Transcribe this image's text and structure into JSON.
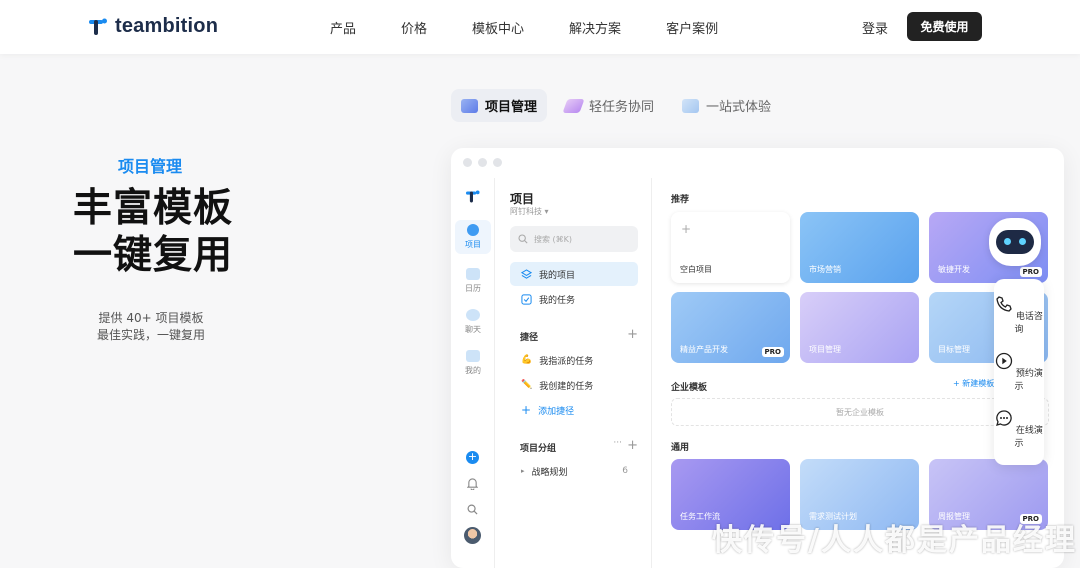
{
  "brand": {
    "name": "teambition"
  },
  "nav": {
    "items": [
      "产品",
      "价格",
      "模板中心",
      "解决方案",
      "客户案例"
    ],
    "login": "登录",
    "cta": "免费使用"
  },
  "hero": {
    "kicker": "项目管理",
    "title_line1": "丰富模板",
    "title_line2": "一键复用",
    "desc_line1": "提供 40+ 项目模板",
    "desc_line2": "最佳实践，一键复用"
  },
  "tabs": [
    {
      "label": "项目管理",
      "icon": "folder-icon",
      "active": true
    },
    {
      "label": "轻任务协同",
      "icon": "eraser-icon",
      "active": false
    },
    {
      "label": "一站式体验",
      "icon": "monitor-icon",
      "active": false
    }
  ],
  "app": {
    "rail": [
      {
        "label": "项目",
        "icon": "project-icon"
      },
      {
        "label": "日历",
        "icon": "calendar-icon"
      },
      {
        "label": "聊天",
        "icon": "chat-icon"
      },
      {
        "label": "我的",
        "icon": "me-icon"
      }
    ],
    "panel": {
      "title": "项目",
      "org": "阿钉科技 ▾",
      "search_placeholder": "搜索 (⌘K)",
      "my_projects": "我的项目",
      "my_tasks": "我的任务",
      "shortcuts_title": "捷径",
      "assigned_tasks": "我指派的任务",
      "created_tasks": "我创建的任务",
      "add_shortcut": "添加捷径",
      "groups_title": "项目分组",
      "group_name": "战略规划",
      "group_count": "6"
    },
    "main": {
      "recommend_title": "推荐",
      "cards_row1": [
        {
          "label": "空白项目",
          "pro": false
        },
        {
          "label": "市场营销",
          "pro": false
        },
        {
          "label": "敏捷开发",
          "pro": true
        }
      ],
      "cards_row2": [
        {
          "label": "精益产品开发",
          "pro": true
        },
        {
          "label": "项目管理",
          "pro": false
        },
        {
          "label": "目标管理",
          "pro": false
        }
      ],
      "enterprise_title": "企业模板",
      "new_template": "+ 新建模板",
      "enterprise_empty": "暂无企业模板",
      "general_title": "通用",
      "cards_row3": [
        {
          "label": "任务工作流",
          "pro": false
        },
        {
          "label": "需求测试计划",
          "pro": false
        },
        {
          "label": "周报管理",
          "pro": true
        }
      ],
      "pro_label": "PRO"
    }
  },
  "float_menu": [
    {
      "label": "电话咨询",
      "icon": "phone-icon"
    },
    {
      "label": "预约演示",
      "icon": "play-icon"
    },
    {
      "label": "在线演示",
      "icon": "message-icon"
    }
  ],
  "watermark": "快传号/人人都是产品经理",
  "colors": {
    "accent": "#1a8bf0",
    "cta_bg": "#222222"
  }
}
